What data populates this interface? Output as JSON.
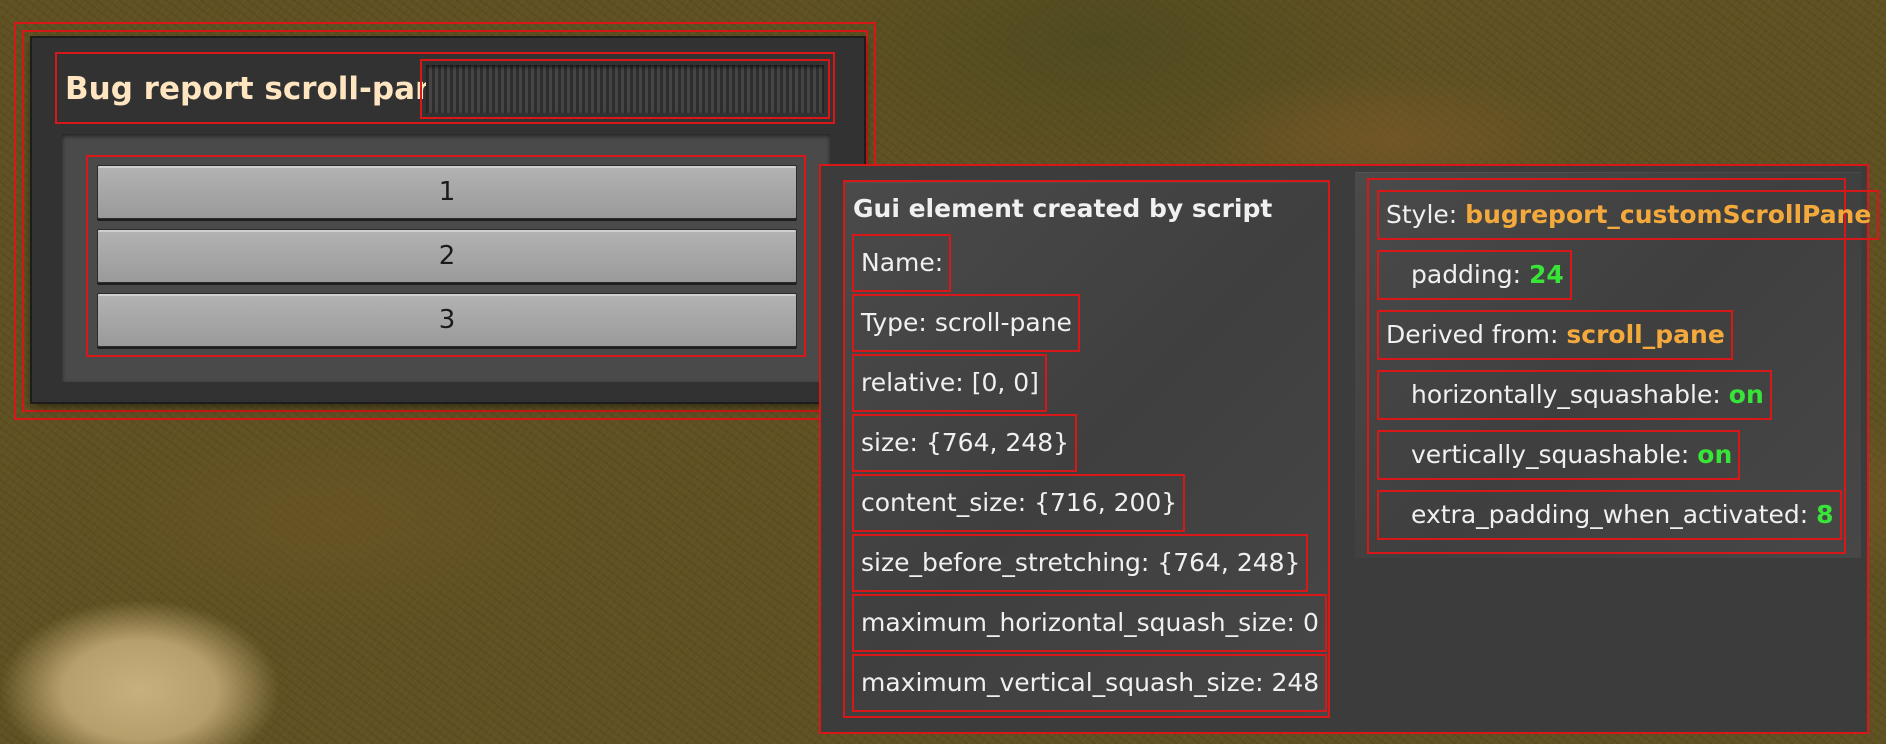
{
  "window": {
    "title": "Bug report scroll-pane",
    "buttons": [
      "1",
      "2",
      "3"
    ]
  },
  "inspector": {
    "heading": "Gui element created by script",
    "properties": [
      {
        "key": "Name:",
        "value": ""
      },
      {
        "key": "Type:",
        "value": "scroll-pane"
      },
      {
        "key": "relative:",
        "value": "[0, 0]"
      },
      {
        "key": "size:",
        "value": "{764, 248}"
      },
      {
        "key": "content_size:",
        "value": "{716, 200}"
      },
      {
        "key": "size_before_stretching:",
        "value": "{764, 248}"
      },
      {
        "key": "maximum_horizontal_squash_size:",
        "value": "0"
      },
      {
        "key": "maximum_vertical_squash_size:",
        "value": "248"
      }
    ]
  },
  "style": {
    "style_label": "Style:",
    "style_value": "bugreport_customScrollPane",
    "padding_label": "padding:",
    "padding_value": "24",
    "derived_label": "Derived from:",
    "derived_value": "scroll_pane",
    "hsq_label": "horizontally_squashable:",
    "hsq_value": "on",
    "vsq_label": "vertically_squashable:",
    "vsq_value": "on",
    "extra_label": "extra_padding_when_activated:",
    "extra_value": "8"
  },
  "colors": {
    "highlight": "#d81818",
    "title": "#ffe6c0",
    "style_value": "#f4a93c",
    "flag_value": "#38e438"
  }
}
